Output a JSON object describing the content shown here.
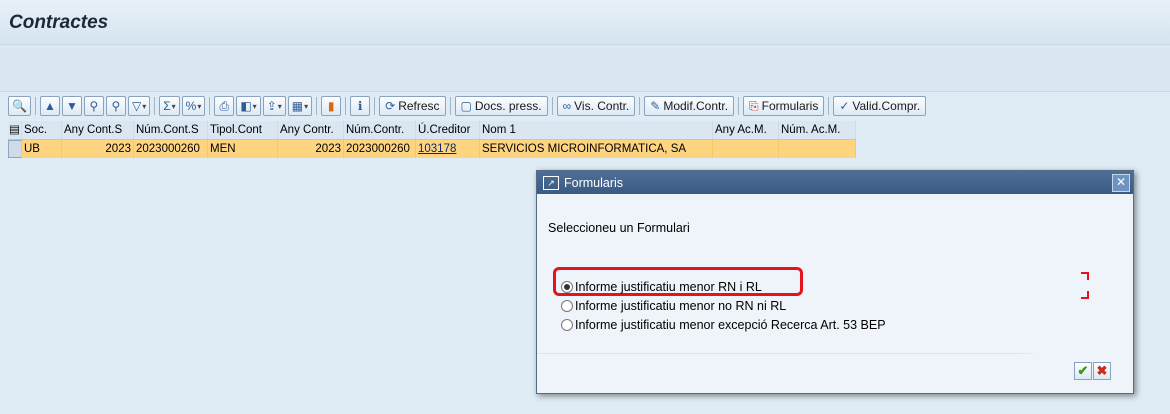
{
  "window": {
    "title": "Contractes"
  },
  "toolbar": {
    "refresh": "Refresc",
    "docs": "Docs. press.",
    "vis": "Vis. Contr.",
    "modif": "Modif.Contr.",
    "formularis": "Formularis",
    "valid": "Valid.Compr."
  },
  "grid": {
    "headers": [
      "Soc.",
      "Any Cont.S",
      "Núm.Cont.S",
      "Tipol.Cont",
      "Any Contr.",
      "Núm.Contr.",
      "Ú.Creditor",
      "Nom 1",
      "Any Ac.M.",
      "Núm. Ac.M."
    ],
    "row": [
      "UB",
      "2023",
      "2023000260",
      "MEN",
      "2023",
      "2023000260",
      "103178",
      "SERVICIOS MICROINFORMATICA, SA",
      "",
      ""
    ]
  },
  "dialog": {
    "title": "Formularis",
    "prompt": "Seleccioneu un Formulari",
    "options": [
      {
        "label": "Informe justificatiu menor RN i RL",
        "selected": true
      },
      {
        "label": "Informe justificatiu menor no RN ni RL",
        "selected": false
      },
      {
        "label": "Informe justificatiu menor excepció Recerca Art. 53 BEP",
        "selected": false
      }
    ]
  },
  "icons": {
    "ok": "check-icon",
    "cancel": "cross-icon",
    "close": "close-icon"
  },
  "colors": {
    "selected_row": "#fed480",
    "highlight": "#e3141b",
    "dialog_title": "#3a5a82"
  }
}
